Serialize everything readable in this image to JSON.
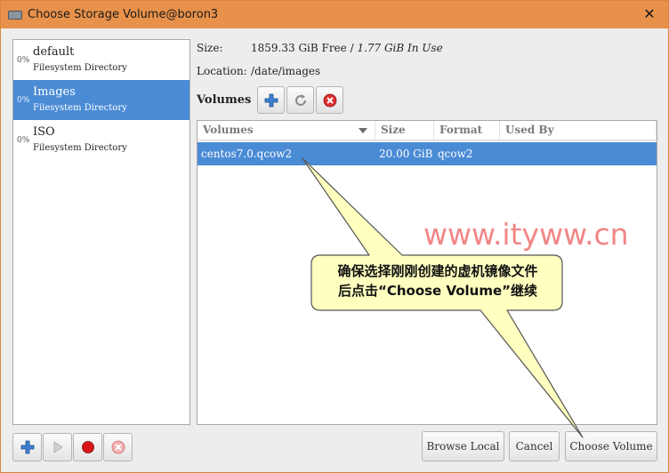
{
  "window": {
    "title": "Choose Storage Volume@boron3",
    "close_glyph": "✕"
  },
  "pools": [
    {
      "pct": "0%",
      "name": "default",
      "type": "Filesystem Directory",
      "selected": false
    },
    {
      "pct": "0%",
      "name": "Images",
      "type": "Filesystem Directory",
      "selected": true
    },
    {
      "pct": "0%",
      "name": "ISO",
      "type": "Filesystem Directory",
      "selected": false
    }
  ],
  "info": {
    "size_label": "Size:",
    "size_free": "1859.33 GiB Free / ",
    "size_used": "1.77 GiB In Use",
    "location_label": "Location:",
    "location_value": "/date/images"
  },
  "volumes": {
    "label": "Volumes",
    "toolbar_icons": [
      "add-icon",
      "refresh-icon",
      "delete-icon"
    ],
    "headers": [
      "Volumes",
      "Size",
      "Format",
      "Used By"
    ],
    "rows": [
      {
        "name": "centos7.0.qcow2",
        "size": "20.00 GiB",
        "format": "qcow2",
        "used_by": ""
      }
    ]
  },
  "bottom": {
    "pool_icons": [
      "add-icon",
      "play-icon",
      "stop-icon",
      "delete-icon"
    ],
    "browse_local": "Browse Local",
    "cancel": "Cancel",
    "choose_volume": "Choose Volume"
  },
  "annotation": {
    "watermark": "www.ityww.cn",
    "line1": "确保选择刚刚创建的虚机镜像文件",
    "line2": "后点击“Choose Volume”继续"
  },
  "colors": {
    "titlebar": "#e8914a",
    "selection": "#4a8bd5",
    "callout_fill": "#ffffc0",
    "watermark": "#f07a7a"
  }
}
